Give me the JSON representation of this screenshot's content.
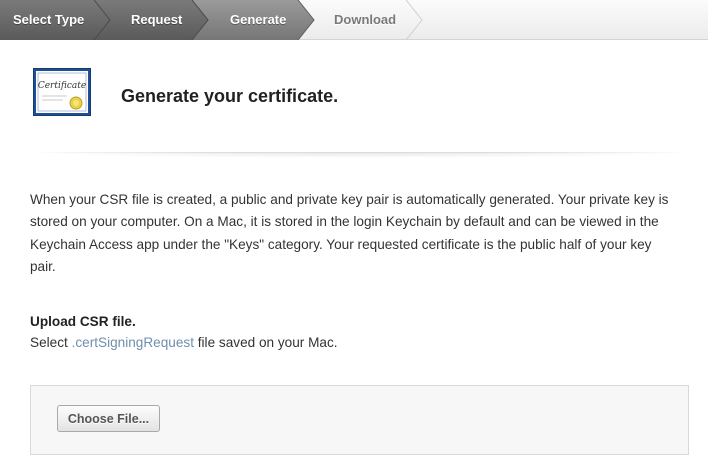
{
  "steps": [
    {
      "label": "Select Type",
      "state": "done"
    },
    {
      "label": "Request",
      "state": "done"
    },
    {
      "label": "Generate",
      "state": "current"
    },
    {
      "label": "Download",
      "state": "pending"
    }
  ],
  "header": {
    "icon": "certificate-icon",
    "icon_text": "Certificate",
    "title": "Generate your certificate."
  },
  "description": "When your CSR file is created, a public and private key pair is automatically generated. Your private key is stored on your computer. On a Mac, it is stored in the login Keychain by default and can be viewed in the Keychain Access app under the \"Keys\" category. Your requested certificate is the public half of your key pair.",
  "upload": {
    "heading": "Upload CSR file.",
    "hint_before": "Select ",
    "hint_ext": ".certSigningRequest",
    "hint_after": " file saved on your Mac.",
    "button_label": "Choose File..."
  },
  "colors": {
    "step_done": "#6a6a6a",
    "step_current": "#8a8a8a",
    "step_pending": "#ececec",
    "link_ext": "#6f8fae"
  }
}
